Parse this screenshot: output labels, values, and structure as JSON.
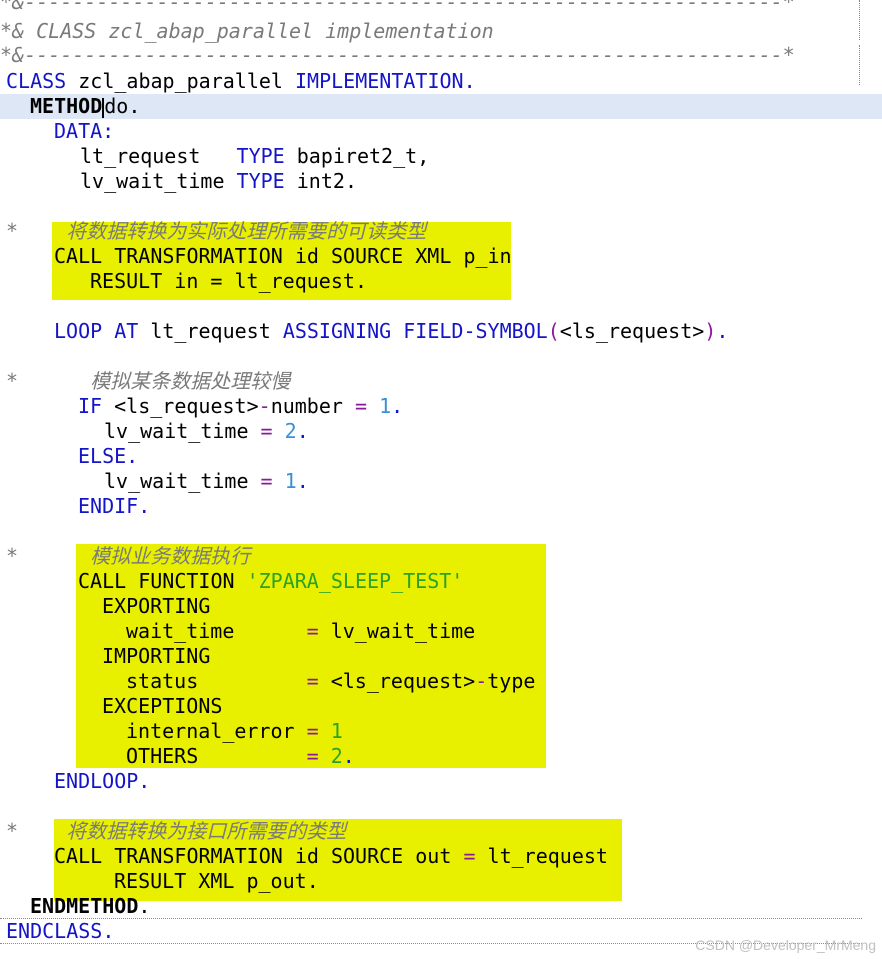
{
  "editor": {
    "header": {
      "border_top": "*&---------------------------------------------------------------*",
      "title": "*& CLASS zcl_abap_parallel implementation",
      "border_bottom": "*&---------------------------------------------------------------*"
    },
    "class_kw": "CLASS",
    "class_name": "zcl_abap_parallel",
    "implementation_kw": "IMPLEMENTATION",
    "method_kw": "METHOD",
    "method_name": "do",
    "data_kw": "DATA",
    "var_request": "lt_request",
    "type_kw": "TYPE",
    "type_request": "bapiret2_t",
    "var_wait": "lv_wait_time",
    "type_wait": "int2",
    "comment1": "将数据转换为实际处理所需要的可读类型",
    "call_transformation": "CALL TRANSFORMATION",
    "id_kw": "id",
    "source_kw": "SOURCE",
    "xml_kw": "XML",
    "p_in": "p_in",
    "result_kw": "RESULT",
    "in_kw": "in",
    "loop_kw": "LOOP AT",
    "assigning_kw": "ASSIGNING",
    "field_symbol_kw": "FIELD-SYMBOL",
    "fs_name": "<ls_request>",
    "comment2": "模拟某条数据处理较慢",
    "if_kw": "IF",
    "number_field": "number",
    "num_1": "1",
    "num_2": "2",
    "else_kw": "ELSE",
    "endif_kw": "ENDIF",
    "comment3": "模拟业务数据执行",
    "call_function": "CALL FUNCTION",
    "function_name": "'ZPARA_SLEEP_TEST'",
    "exporting_kw": "EXPORTING",
    "param_wait_time": "wait_time",
    "importing_kw": "IMPORTING",
    "param_status": "status",
    "type_field": "type",
    "exceptions_kw": "EXCEPTIONS",
    "exc_internal": "internal_error",
    "exc_others": "OTHERS",
    "endloop_kw": "ENDLOOP",
    "comment4": "将数据转换为接口所需要的类型",
    "out_kw": "out",
    "p_out": "p_out",
    "endmethod_kw": "ENDMETHOD",
    "endclass_kw": "ENDCLASS"
  },
  "watermark": "CSDN @Developer_MrMeng",
  "colors": {
    "keyword": "#1414c8",
    "comment": "#7a7a7a",
    "string": "#2aa22a",
    "number": "#3a8fd8",
    "operator": "#8a1a9a",
    "highlight": "#e8f000",
    "current_line": "#dde7f5"
  }
}
